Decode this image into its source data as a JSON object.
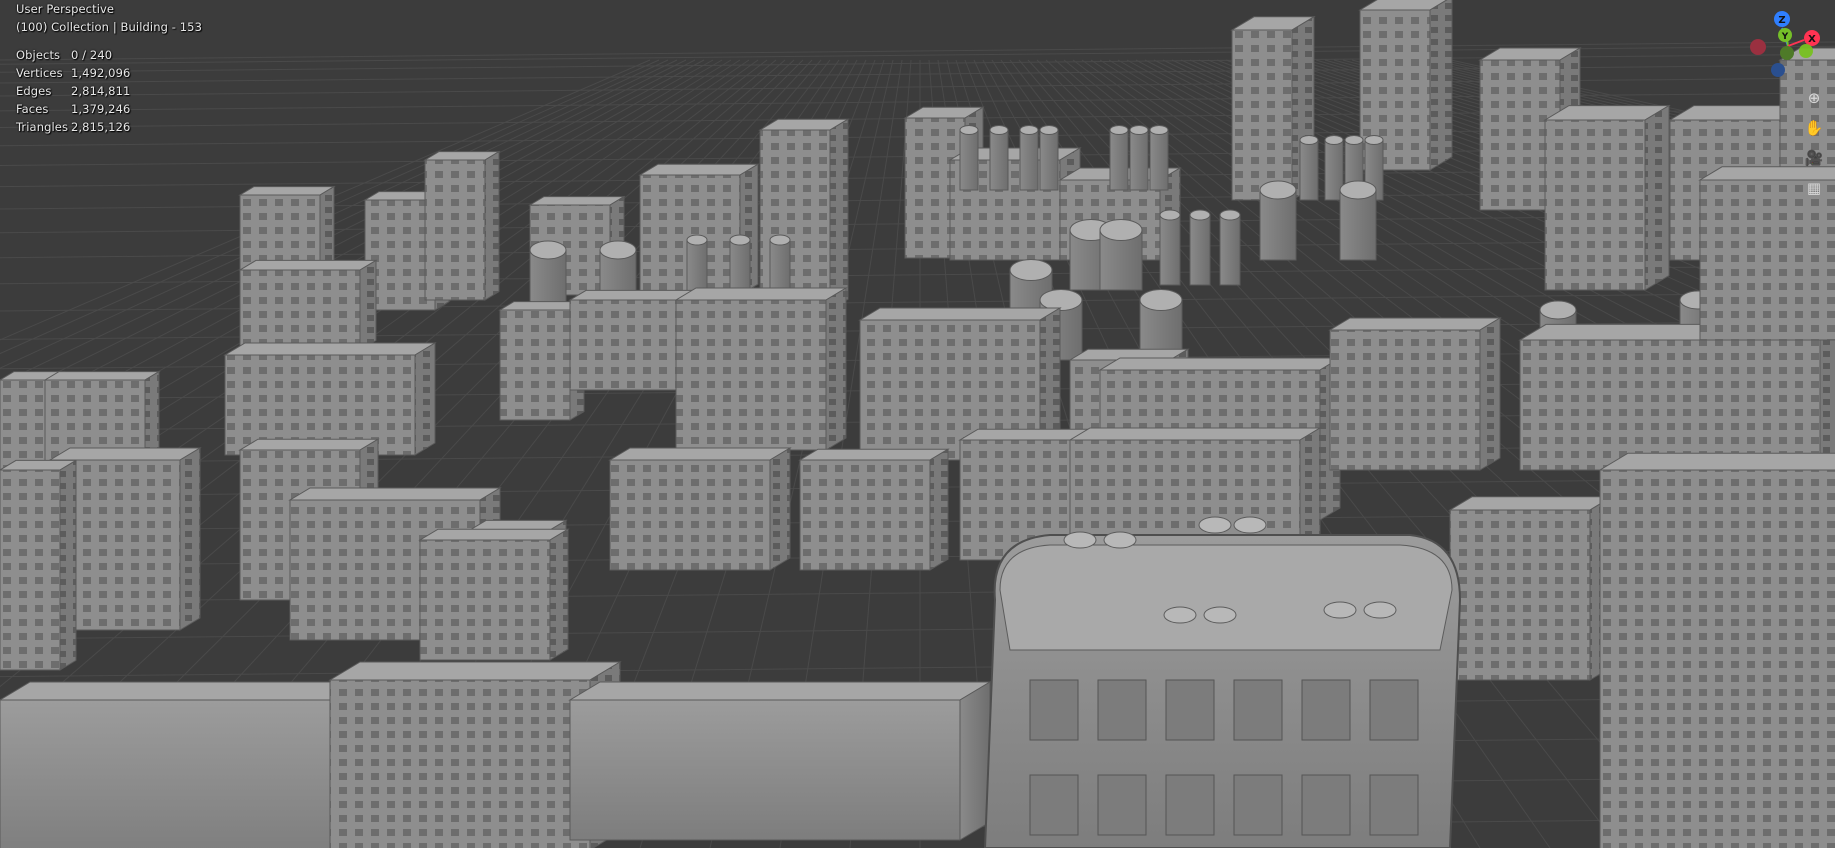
{
  "viewport": {
    "view_name": "User Perspective",
    "collection_info": "(100) Collection | Building - 153",
    "background_color": "#3c3c3c",
    "grid_color": "#4a4a4a"
  },
  "stats": [
    {
      "label": "Objects",
      "value": "0 / 240"
    },
    {
      "label": "Vertices",
      "value": "1,492,096"
    },
    {
      "label": "Edges",
      "value": "2,814,811"
    },
    {
      "label": "Faces",
      "value": "1,379,246"
    },
    {
      "label": "Triangles",
      "value": "2,815,126"
    }
  ],
  "gizmo": {
    "axes": [
      {
        "label": "Z",
        "color": "#2f7fff"
      },
      {
        "label": "Y",
        "color": "#75c028"
      },
      {
        "label": "X",
        "color": "#ff3352"
      }
    ]
  },
  "nav_controls": [
    {
      "name": "zoom-icon",
      "glyph": "⊕"
    },
    {
      "name": "pan-icon",
      "glyph": "✋"
    },
    {
      "name": "camera-icon",
      "glyph": "🎥"
    },
    {
      "name": "grid-view-icon",
      "glyph": "▦"
    }
  ]
}
